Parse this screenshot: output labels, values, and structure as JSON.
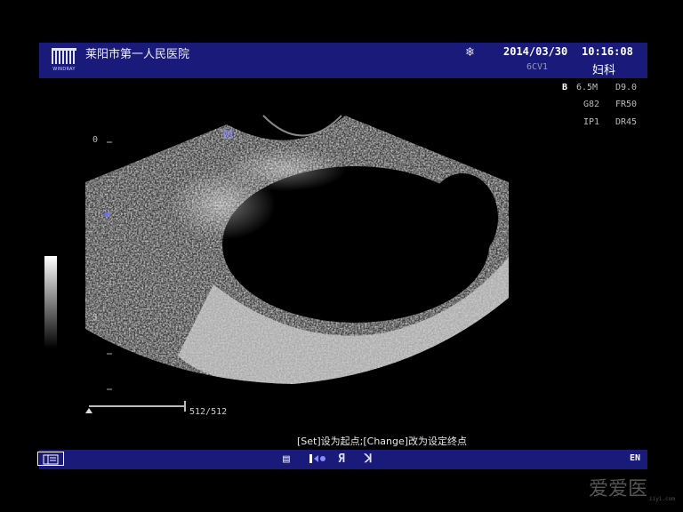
{
  "header": {
    "hospital": "莱阳市第一人民医院",
    "logo_text": "WINDRAY",
    "freeze_icon": "snowflake-icon",
    "date": "2014/03/30",
    "time": "10:16:08",
    "probe": "6CV1",
    "department": "妇科"
  },
  "params": {
    "mode": "B",
    "freq": "6.5M",
    "depth": "D9.0",
    "gain": "G82",
    "frame_rate": "FR50",
    "image_proc": "IP1",
    "dynamic_range": "DR45"
  },
  "scale": {
    "tick_0": "0",
    "tick_5": "5"
  },
  "cine": {
    "frames": "512/512"
  },
  "hint": "[Set]设为起点;[Change]改为设定终点",
  "bottombar": {
    "icons": [
      "panel-icon",
      "report-icon",
      "marker-icon",
      "r-icon",
      "l-icon"
    ],
    "input_mode": "EN"
  },
  "watermark": {
    "text": "爱爱医",
    "url": "iiyi.com"
  }
}
